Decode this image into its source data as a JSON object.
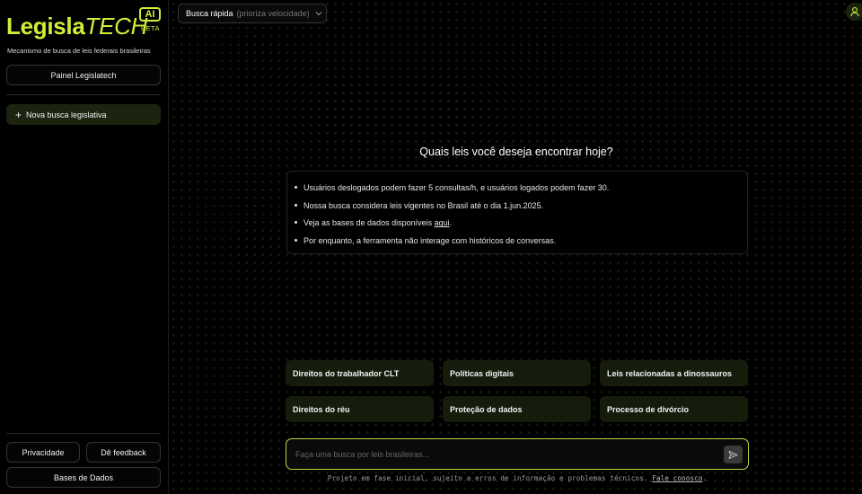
{
  "sidebar": {
    "logo": {
      "word": "Legisla",
      "word2": "TECH",
      "badge": "AI",
      "beta": "BETA"
    },
    "tagline": "Mecanismo de busca de leis federais brasileiras",
    "panel_button": "Painel Legislatech",
    "new_search": "Nova busca legislativa",
    "privacy": "Privacidade",
    "feedback": "Dê feedback",
    "databases": "Bases de Dados"
  },
  "header": {
    "mode_label": "Busca rápida",
    "mode_hint": "(prioriza velocidade)"
  },
  "main": {
    "heading": "Quais leis você deseja encontrar hoje?",
    "info": [
      "Usuários deslogados podem fazer 5 consultas/h, e usuários logados podem fazer 30.",
      "Nossa busca considera leis vigentes no Brasil até o dia 1.jun.2025.",
      "Veja as bases de dados disponíveis ",
      "Por enquanto, a ferramenta não interage com históricos de conversas."
    ],
    "info_link": "aqui",
    "info_link_suffix": ".",
    "suggestions": [
      "Direitos do trabalhador CLT",
      "Políticas digitais",
      "Leis relacionadas a dinossauros",
      "Direitos do réu",
      "Proteção de dados",
      "Processo de divórcio"
    ],
    "search_placeholder": "Faça uma busca por leis brasileiras...",
    "footer_text": "Projeto em fase inicial, sujeito a erros de informação e problemas técnicos. ",
    "footer_link": "Fale conosco",
    "footer_suffix": "."
  },
  "colors": {
    "accent": "#cfee3a",
    "background": "#000000",
    "card": "#161c0c"
  },
  "icons": [
    "plus-icon",
    "chevron-down-icon",
    "user-icon",
    "send-icon"
  ]
}
